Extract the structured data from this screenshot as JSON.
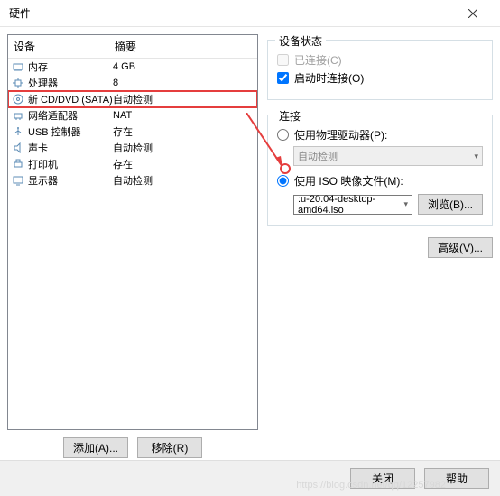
{
  "window": {
    "title": "硬件"
  },
  "left": {
    "header_device": "设备",
    "header_summary": "摘要",
    "rows": [
      {
        "icon": "memory",
        "device": "内存",
        "summary": "4 GB"
      },
      {
        "icon": "cpu",
        "device": "处理器",
        "summary": "8"
      },
      {
        "icon": "disc",
        "device": "新 CD/DVD (SATA)",
        "summary": "自动检测",
        "highlight": true
      },
      {
        "icon": "net",
        "device": "网络适配器",
        "summary": "NAT"
      },
      {
        "icon": "usb",
        "device": "USB 控制器",
        "summary": "存在"
      },
      {
        "icon": "sound",
        "device": "声卡",
        "summary": "自动检测"
      },
      {
        "icon": "printer",
        "device": "打印机",
        "summary": "存在"
      },
      {
        "icon": "display",
        "device": "显示器",
        "summary": "自动检测"
      }
    ],
    "add_btn": "添加(A)...",
    "remove_btn": "移除(R)"
  },
  "status": {
    "group_title": "设备状态",
    "connected": "已连接(C)",
    "connect_on_power": "启动时连接(O)"
  },
  "connection": {
    "group_title": "连接",
    "use_physical": "使用物理驱动器(P):",
    "physical_value": "自动检测",
    "use_iso": "使用 ISO 映像文件(M):",
    "iso_value": ":u-20.04-desktop-amd64.iso",
    "browse_btn": "浏览(B)..."
  },
  "advanced_btn": "高级(V)...",
  "footer": {
    "close": "关闭",
    "help": "帮助"
  },
  "watermark": "https://blog.csdn.net/qq/12257982"
}
